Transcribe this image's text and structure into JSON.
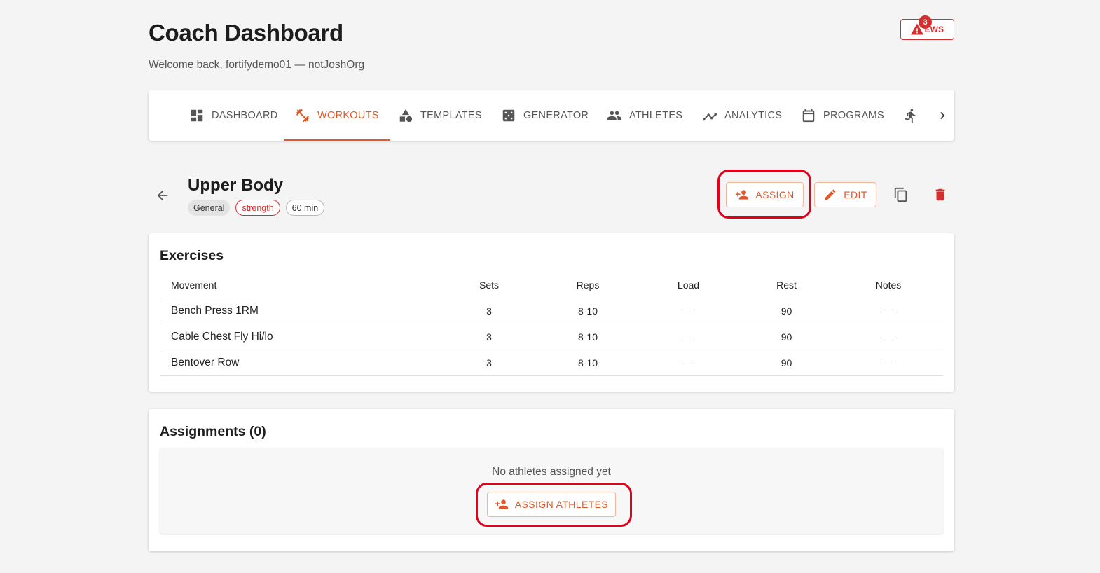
{
  "header": {
    "title": "Coach Dashboard",
    "welcome": "Welcome back, fortifydemo01 — notJoshOrg",
    "ews_label": "EWS",
    "ews_count": "3"
  },
  "nav": {
    "tabs": [
      {
        "label": "DASHBOARD",
        "icon": "dashboard-icon"
      },
      {
        "label": "WORKOUTS",
        "icon": "fitness-icon",
        "active": true
      },
      {
        "label": "TEMPLATES",
        "icon": "category-icon"
      },
      {
        "label": "GENERATOR",
        "icon": "dice-icon"
      },
      {
        "label": "ATHLETES",
        "icon": "people-icon"
      },
      {
        "label": "ANALYTICS",
        "icon": "analytics-icon"
      },
      {
        "label": "PROGRAMS",
        "icon": "calendar-icon"
      }
    ],
    "accent": "#e0592a"
  },
  "workout": {
    "title": "Upper Body",
    "chips": [
      "General",
      "strength",
      "60 min"
    ],
    "assign_label": "ASSIGN",
    "edit_label": "EDIT"
  },
  "exercises": {
    "title": "Exercises",
    "columns": [
      "Movement",
      "Sets",
      "Reps",
      "Load",
      "Rest",
      "Notes"
    ],
    "rows": [
      {
        "movement": "Bench Press 1RM",
        "sets": "3",
        "reps": "8-10",
        "load": "—",
        "rest": "90",
        "notes": "—"
      },
      {
        "movement": "Cable Chest Fly Hi/lo",
        "sets": "3",
        "reps": "8-10",
        "load": "—",
        "rest": "90",
        "notes": "—"
      },
      {
        "movement": "Bentover Row",
        "sets": "3",
        "reps": "8-10",
        "load": "—",
        "rest": "90",
        "notes": "—"
      }
    ]
  },
  "assignments": {
    "title": "Assignments (0)",
    "empty_text": "No athletes assigned yet",
    "assign_athletes_label": "ASSIGN ATHLETES"
  },
  "colors": {
    "accent": "#e0592a",
    "danger": "#d32f2f",
    "highlight": "#e4001b"
  }
}
